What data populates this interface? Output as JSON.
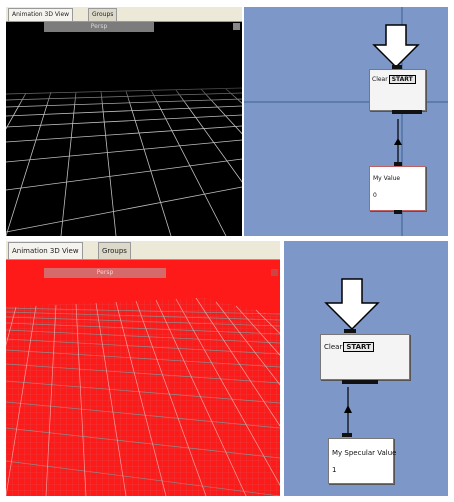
{
  "top": {
    "tabs": [
      "Animation 3D View",
      "Groups"
    ],
    "view_header": "Persp",
    "node_start": {
      "prefix": "Clear",
      "tag": "START"
    },
    "node_value": {
      "label": "My Value",
      "value": "0"
    }
  },
  "bottom": {
    "tabs": [
      "Animation 3D View",
      "Groups"
    ],
    "view_header": "Persp",
    "node_start": {
      "prefix": "Clear",
      "tag": "START"
    },
    "node_value": {
      "label": "My Specular Value",
      "value": "1"
    }
  },
  "colors": {
    "viewport_top_bg": "#000000",
    "viewport_bottom_bg": "#ff1a1a",
    "graph_bg": "#7d98c8"
  },
  "icons": [
    "start-arrow-icon",
    "connector-arrow-icon"
  ]
}
